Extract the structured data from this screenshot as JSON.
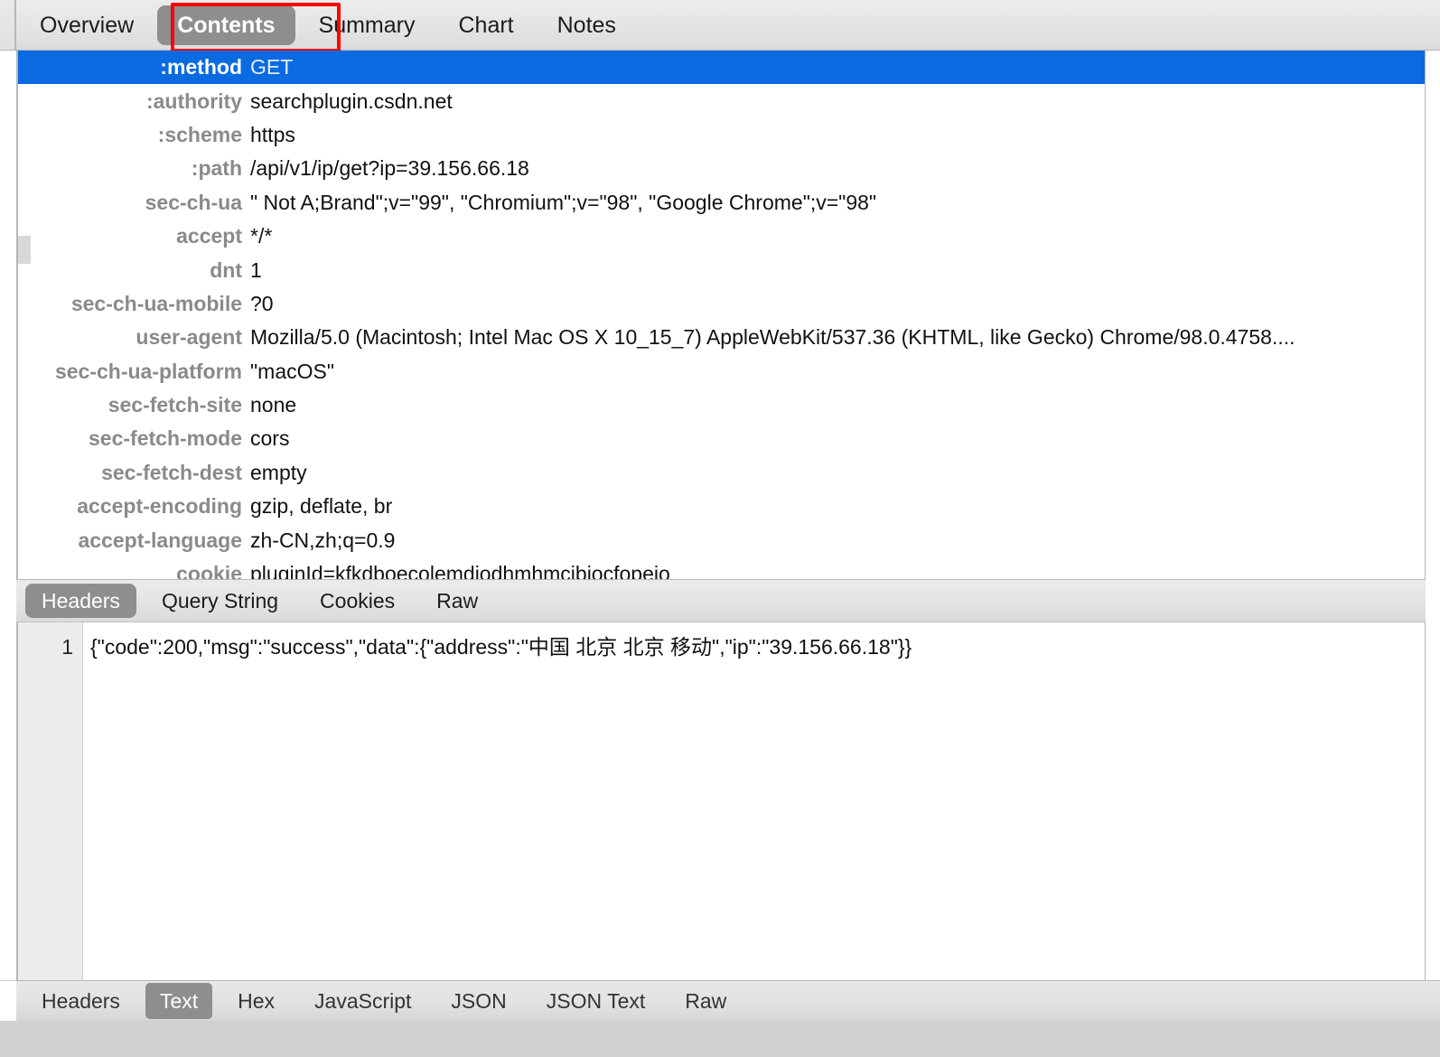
{
  "window": {
    "accent_selected_row": "#0a6ae0",
    "accent_tab_selected": "#8e8e8e",
    "highlight_box_color": "#ff0000"
  },
  "top_tabs": [
    {
      "label": "Overview",
      "selected": false
    },
    {
      "label": "Contents",
      "selected": true
    },
    {
      "label": "Summary",
      "selected": false
    },
    {
      "label": "Chart",
      "selected": false
    },
    {
      "label": "Notes",
      "selected": false
    }
  ],
  "headers": {
    "rows": [
      {
        "name": ":method",
        "value": "GET",
        "selected": true
      },
      {
        "name": ":authority",
        "value": "searchplugin.csdn.net",
        "selected": false
      },
      {
        "name": ":scheme",
        "value": "https",
        "selected": false
      },
      {
        "name": ":path",
        "value": "/api/v1/ip/get?ip=39.156.66.18",
        "selected": false
      },
      {
        "name": "sec-ch-ua",
        "value": "\" Not A;Brand\";v=\"99\", \"Chromium\";v=\"98\", \"Google Chrome\";v=\"98\"",
        "selected": false
      },
      {
        "name": "accept",
        "value": "*/*",
        "selected": false
      },
      {
        "name": "dnt",
        "value": "1",
        "selected": false
      },
      {
        "name": "sec-ch-ua-mobile",
        "value": "?0",
        "selected": false
      },
      {
        "name": "user-agent",
        "value": "Mozilla/5.0 (Macintosh; Intel Mac OS X 10_15_7) AppleWebKit/537.36 (KHTML, like Gecko) Chrome/98.0.4758....",
        "selected": false
      },
      {
        "name": "sec-ch-ua-platform",
        "value": "\"macOS\"",
        "selected": false
      },
      {
        "name": "sec-fetch-site",
        "value": "none",
        "selected": false
      },
      {
        "name": "sec-fetch-mode",
        "value": "cors",
        "selected": false
      },
      {
        "name": "sec-fetch-dest",
        "value": "empty",
        "selected": false
      },
      {
        "name": "accept-encoding",
        "value": "gzip, deflate, br",
        "selected": false
      },
      {
        "name": "accept-language",
        "value": "zh-CN,zh;q=0.9",
        "selected": false
      },
      {
        "name": "cookie",
        "value": "pluginId=kfkdboecolemdjodhmhmcibjocfopeio",
        "selected": false
      }
    ]
  },
  "request_tabs": [
    {
      "label": "Headers",
      "selected": true
    },
    {
      "label": "Query String",
      "selected": false
    },
    {
      "label": "Cookies",
      "selected": false
    },
    {
      "label": "Raw",
      "selected": false
    }
  ],
  "body": {
    "line_number": "1",
    "content": "{\"code\":200,\"msg\":\"success\",\"data\":{\"address\":\"中国 北京 北京 移动\",\"ip\":\"39.156.66.18\"}}"
  },
  "response_tabs": [
    {
      "label": "Headers",
      "selected": false
    },
    {
      "label": "Text",
      "selected": true
    },
    {
      "label": "Hex",
      "selected": false
    },
    {
      "label": "JavaScript",
      "selected": false
    },
    {
      "label": "JSON",
      "selected": false
    },
    {
      "label": "JSON Text",
      "selected": false
    },
    {
      "label": "Raw",
      "selected": false
    }
  ]
}
